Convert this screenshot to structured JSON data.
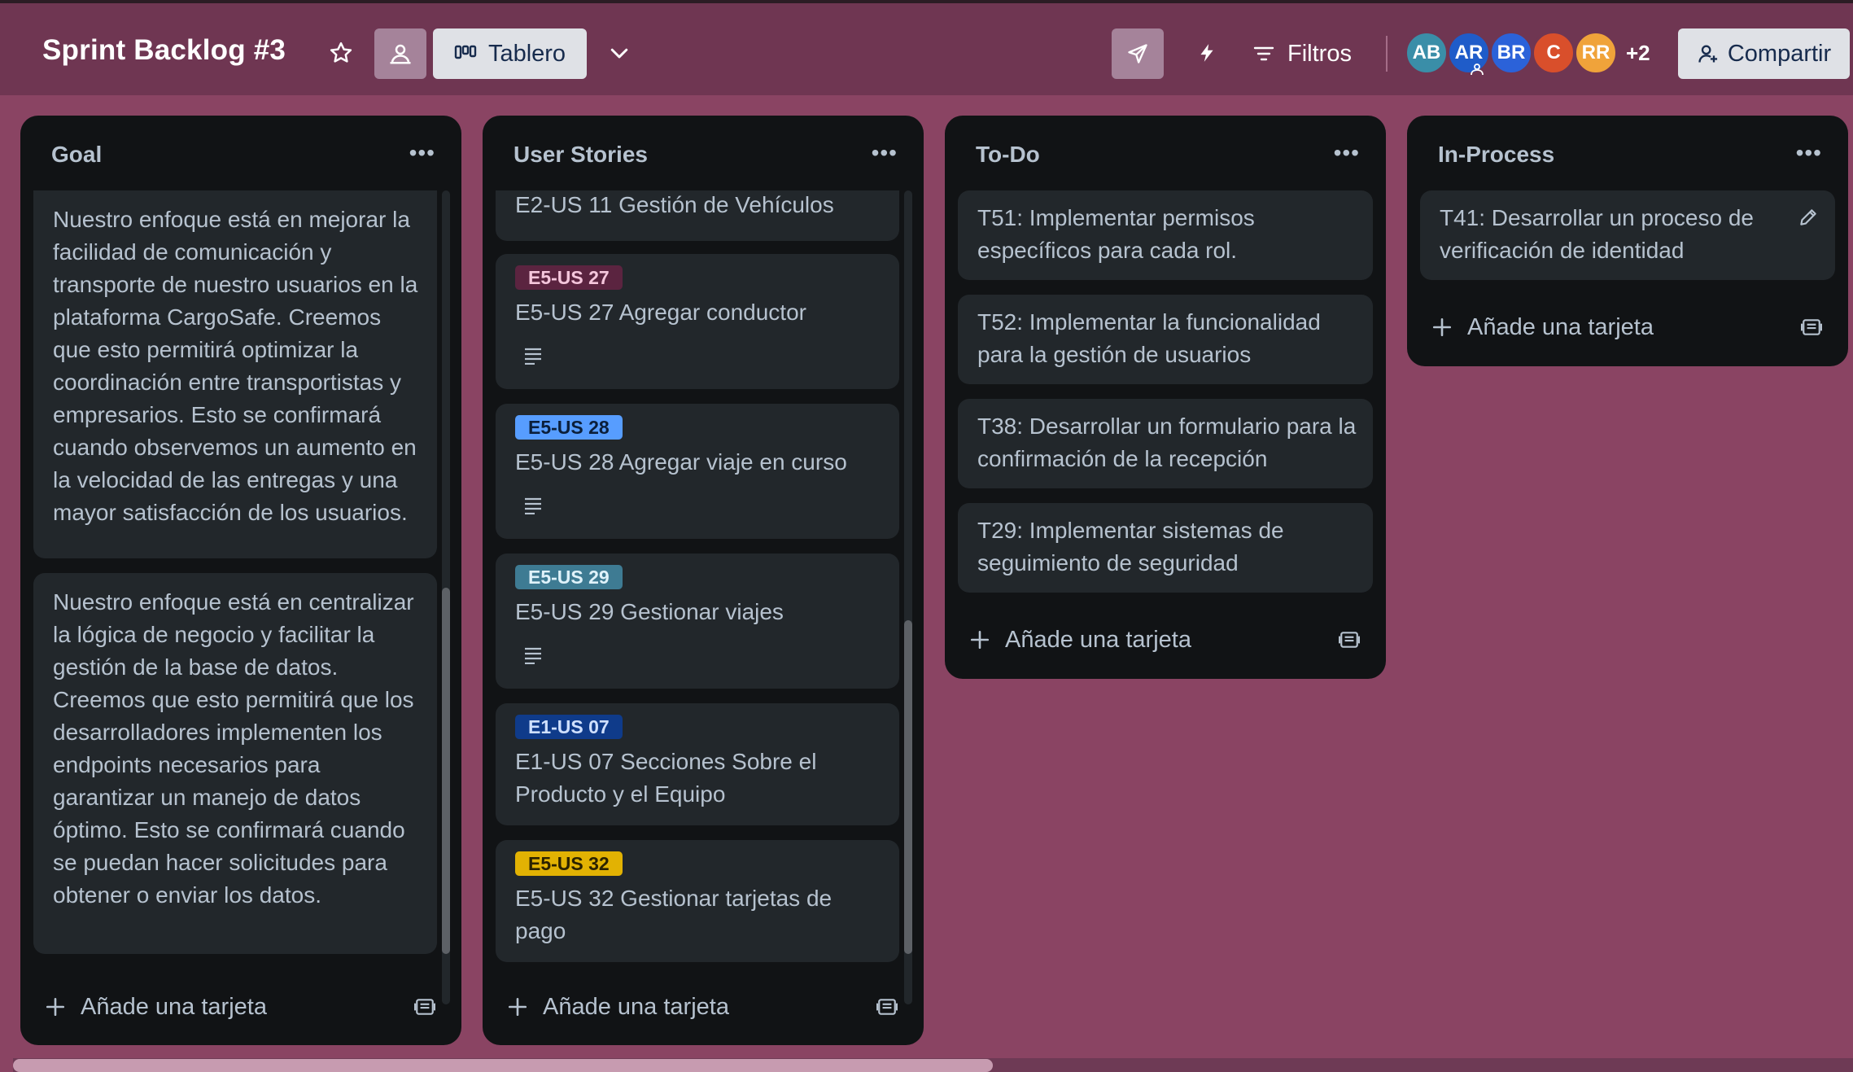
{
  "board": {
    "title": "Sprint Backlog #3",
    "view_label": "Tablero",
    "filter_label": "Filtros",
    "share_label": "Compartir",
    "more_members": "+2",
    "members": [
      {
        "initials": "AB",
        "color": "#3a8ea8"
      },
      {
        "initials": "AR",
        "color": "#1f5cc9"
      },
      {
        "initials": "BR",
        "color": "#2b62d9"
      },
      {
        "initials": "C",
        "color": "#d94f2b"
      },
      {
        "initials": "RR",
        "color": "#f0a33a"
      }
    ]
  },
  "colors": {
    "board_background": "#8a4463",
    "header_background": "#6f3652",
    "list_background": "#111315",
    "card_background": "#22272b"
  },
  "lists": [
    {
      "title": "Goal",
      "add_label": "Añade una tarjeta",
      "cards": [
        {
          "text": "Nuestro enfoque está en mejorar la facilidad de comunicación y transporte de nuestro usuarios en la plataforma CargoSafe. Creemos que esto permitirá optimizar la coordinación entre transportistas y empresarios. Esto se confirmará cuando observemos un aumento en la velocidad de las entregas y una mayor satisfacción de los usuarios."
        },
        {
          "text": "Nuestro enfoque está en centralizar la lógica de negocio y facilitar la gestión de la base de datos. Creemos que esto permitirá que los desarrolladores implementen los endpoints necesarios para garantizar un manejo de datos óptimo. Esto se confirmará cuando se puedan hacer solicitudes para obtener o enviar los datos."
        }
      ]
    },
    {
      "title": "User Stories",
      "add_label": "Añade una tarjeta",
      "cards": [
        {
          "text": "E2-US 11 Gestión de Vehículos"
        },
        {
          "label": "E5-US 27",
          "label_color": "#5b2440",
          "label_text_color": "#f5c6dc",
          "text": "E5-US 27 Agregar conductor",
          "description_icon": "description-icon"
        },
        {
          "label": "E5-US 28",
          "label_color": "#579dff",
          "label_text_color": "#0b1f3a",
          "text": "E5-US 28 Agregar viaje en curso",
          "description_icon": "description-icon"
        },
        {
          "label": "E5-US 29",
          "label_color": "#3e7b93",
          "label_text_color": "#dff2fa",
          "text": "E5-US 29 Gestionar viajes",
          "description_icon": "description-icon"
        },
        {
          "label": "E1-US 07",
          "label_color": "#0f3b8a",
          "label_text_color": "#cfe0ff",
          "text": "E1-US 07 Secciones Sobre el Producto y el Equipo"
        },
        {
          "label": "E5-US 32",
          "label_color": "#e2b203",
          "label_text_color": "#2b2200",
          "text": "E5-US 32 Gestionar tarjetas de pago"
        }
      ]
    },
    {
      "title": "To-Do",
      "add_label": "Añade una tarjeta",
      "cards": [
        {
          "text": "T51: Implementar permisos específicos para cada rol."
        },
        {
          "text": "T52: Implementar la funcionalidad para la gestión de usuarios"
        },
        {
          "text": "T38: Desarrollar un formulario para la confirmación de la recepción"
        },
        {
          "text": "T29: Implementar sistemas de seguimiento de seguridad"
        }
      ]
    },
    {
      "title": "In-Process",
      "add_label": "Añade una tarjeta",
      "cards": [
        {
          "text": "T41: Desarrollar un proceso de verificación de identidad"
        }
      ]
    }
  ]
}
